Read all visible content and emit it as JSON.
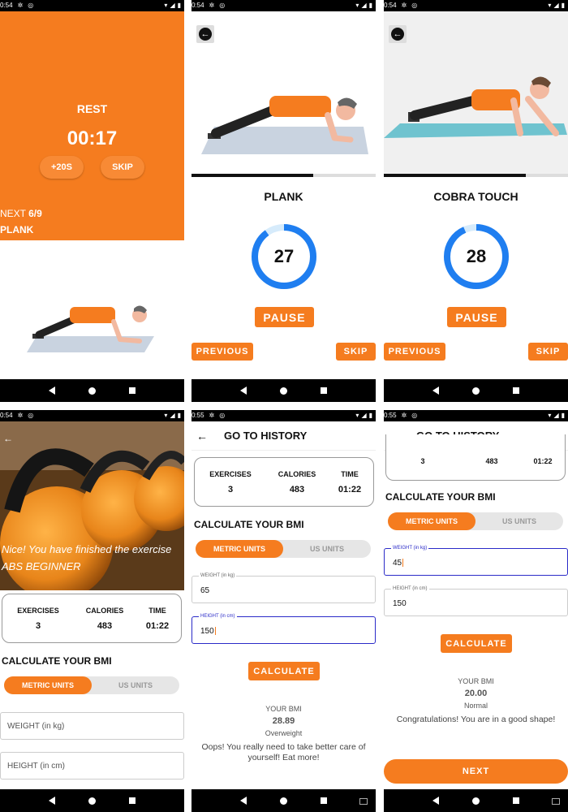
{
  "status": {
    "time_a": "0:54",
    "time_b": "0:55"
  },
  "rest": {
    "label": "REST",
    "timer": "00:17",
    "add_button": "+20S",
    "skip_button": "SKIP",
    "next_label": "NEXT ",
    "next_count": "6/9",
    "next_exercise": "PLANK"
  },
  "exercise_plank": {
    "name": "PLANK",
    "count": "27",
    "progress": 0.66,
    "pause": "PAUSE",
    "previous": "PREVIOUS",
    "skip": "SKIP"
  },
  "exercise_cobra": {
    "name": "COBRA TOUCH",
    "count": "28",
    "progress": 0.77,
    "pause": "PAUSE",
    "previous": "PREVIOUS",
    "skip": "SKIP"
  },
  "summary": {
    "finish_message": "Nice! You have finished the exercise",
    "workout_name": "ABS BEGINNER",
    "stats": {
      "exercises_label": "EXERCISES",
      "exercises_value": "3",
      "calories_label": "CALORIES",
      "calories_value": "483",
      "time_label": "TIME",
      "time_value": "01:22"
    },
    "bmi_title": "CALCULATE YOUR BMI",
    "metric_units": "METRIC UNITS",
    "us_units": "US UNITS",
    "weight_label": "WEIGHT (in kg)",
    "height_label": "HEIGHT (in cm)"
  },
  "history_a": {
    "title": "GO TO HISTORY",
    "weight_value": "65",
    "height_value": "150",
    "calculate": "CALCULATE",
    "bmi_label": "YOUR BMI",
    "bmi_value": "28.89",
    "bmi_category": "Overweight",
    "bmi_message": "Oops! You really need to take better care of yourself! Eat more!"
  },
  "history_b": {
    "title": "GO TO HISTORY",
    "weight_value": "45",
    "height_value": "150",
    "calculate": "CALCULATE",
    "bmi_label": "YOUR BMI",
    "bmi_value": "20.00",
    "bmi_category": "Normal",
    "bmi_message": "Congratulations! You are in a good shape!",
    "next": "NEXT"
  },
  "colors": {
    "accent": "#f57c1f",
    "ring": "#1f7ef0",
    "ring_track": "#d6ebfb",
    "focus": "#2b2bc8"
  }
}
